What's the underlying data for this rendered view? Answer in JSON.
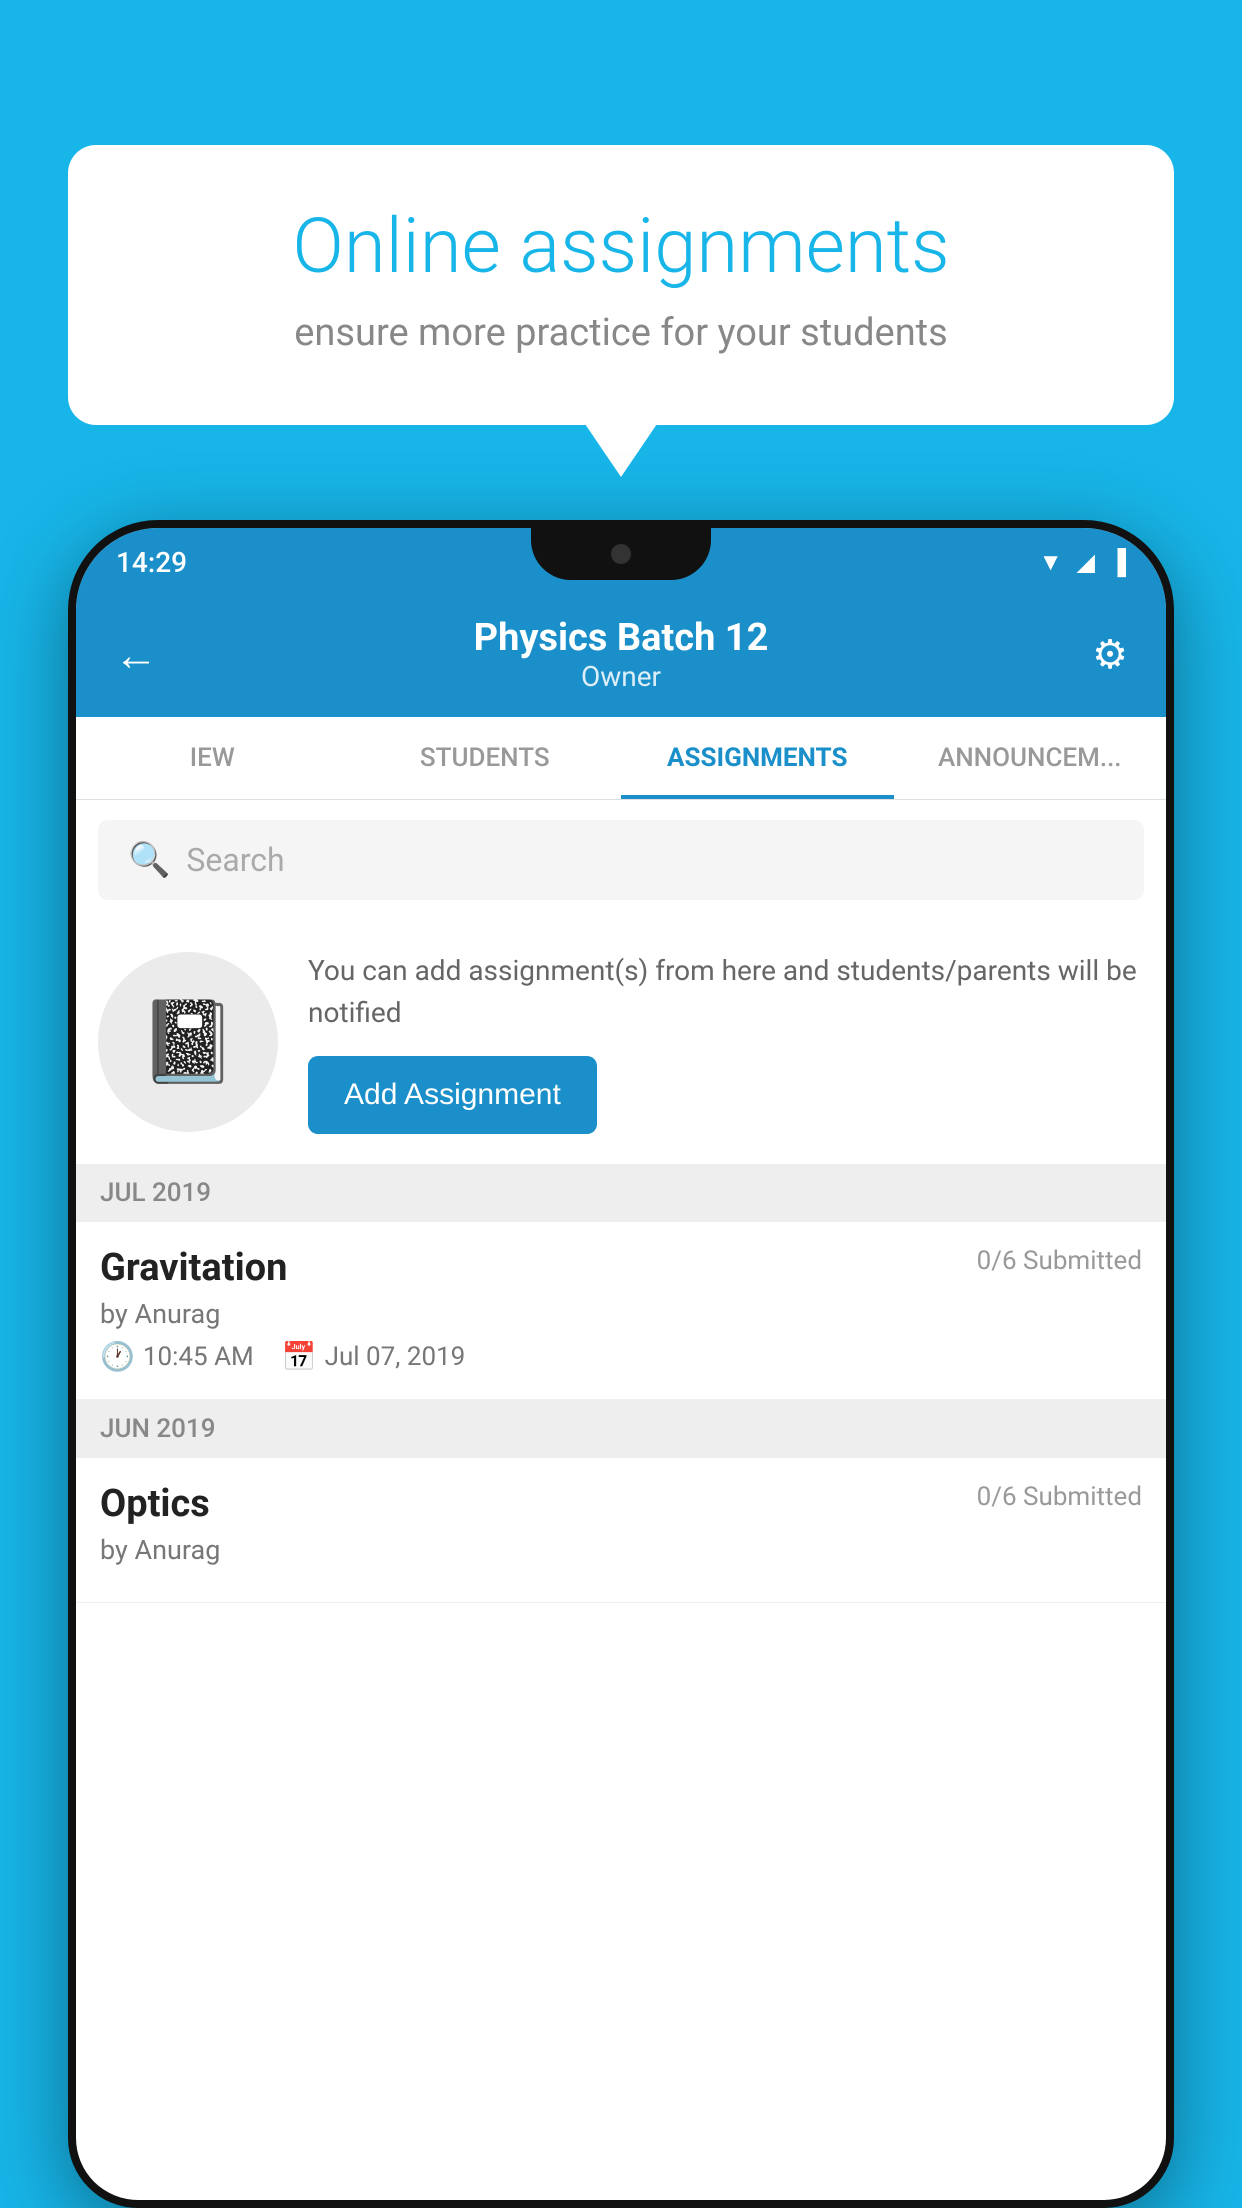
{
  "background": {
    "color": "#17b5e8"
  },
  "speech_bubble": {
    "title": "Online assignments",
    "subtitle": "ensure more practice for your students"
  },
  "status_bar": {
    "time": "14:29",
    "icons": [
      "wifi",
      "signal",
      "battery"
    ]
  },
  "app_header": {
    "title": "Physics Batch 12",
    "subtitle": "Owner",
    "back_label": "←",
    "settings_label": "⚙"
  },
  "tabs": [
    {
      "label": "IEW",
      "active": false
    },
    {
      "label": "STUDENTS",
      "active": false
    },
    {
      "label": "ASSIGNMENTS",
      "active": true
    },
    {
      "label": "ANNOUNCEMENTS",
      "active": false
    }
  ],
  "search": {
    "placeholder": "Search"
  },
  "promo": {
    "text": "You can add assignment(s) from here and students/parents will be notified",
    "button_label": "Add Assignment"
  },
  "sections": [
    {
      "label": "JUL 2019",
      "assignments": [
        {
          "title": "Gravitation",
          "submitted": "0/6 Submitted",
          "by": "by Anurag",
          "time": "10:45 AM",
          "date": "Jul 07, 2019"
        }
      ]
    },
    {
      "label": "JUN 2019",
      "assignments": [
        {
          "title": "Optics",
          "submitted": "0/6 Submitted",
          "by": "by Anurag",
          "time": "",
          "date": ""
        }
      ]
    }
  ]
}
